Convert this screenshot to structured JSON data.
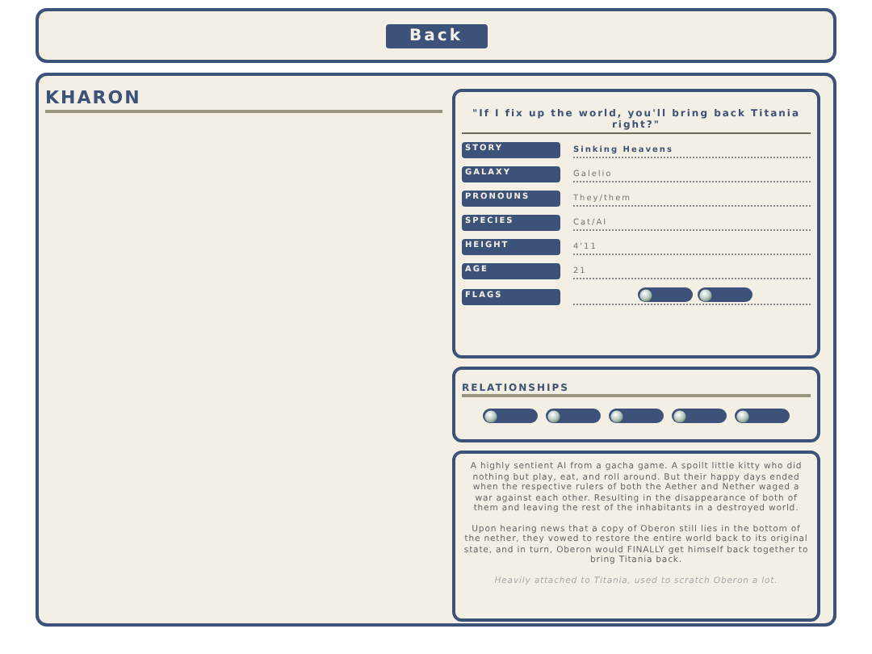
{
  "back_button": "Back",
  "name": "KHARON",
  "quote": "\"If I fix up the world, you'll bring back Titania right?\"",
  "fields": [
    {
      "label": "STORY",
      "value": "Sinking Heavens",
      "kind": "bold"
    },
    {
      "label": "GALAXY",
      "value": "Galelio",
      "kind": "text"
    },
    {
      "label": "PRONOUNS",
      "value": "They/them",
      "kind": "text"
    },
    {
      "label": "SPECIES",
      "value": "Cat/AI",
      "kind": "text"
    },
    {
      "label": "HEIGHT",
      "value": "4'11",
      "kind": "text"
    },
    {
      "label": "AGE",
      "value": "21",
      "kind": "text"
    },
    {
      "label": "FLAGS",
      "kind": "pills",
      "pills": [
        {
          "kind": "pill"
        },
        {
          "kind": "pill"
        }
      ]
    }
  ],
  "relationships": {
    "title": "RELATIONSHIPS",
    "pills": [
      {
        "kind": "pill"
      },
      {
        "kind": "pill"
      },
      {
        "kind": "pill"
      },
      {
        "kind": "pill"
      },
      {
        "kind": "pill"
      }
    ]
  },
  "description": {
    "paragraphs": [
      "A highly sentient AI from a gacha game. A spoilt little kitty who did nothing but play, eat, and roll around. But their happy days ended when the respective rulers of both the Aether and Nether waged a war against each other. Resulting in the disappearance of both of them and leaving the rest of the inhabitants in a destroyed world.",
      "Upon hearing news that a copy of Oberon still lies in the bottom of the nether, they vowed to restore the entire world back to its original state, and in turn, Oberon would FINALLY get himself back together to bring Titania back."
    ],
    "note": "Heavily attached to Titania, used to scratch Oberon a lot."
  }
}
